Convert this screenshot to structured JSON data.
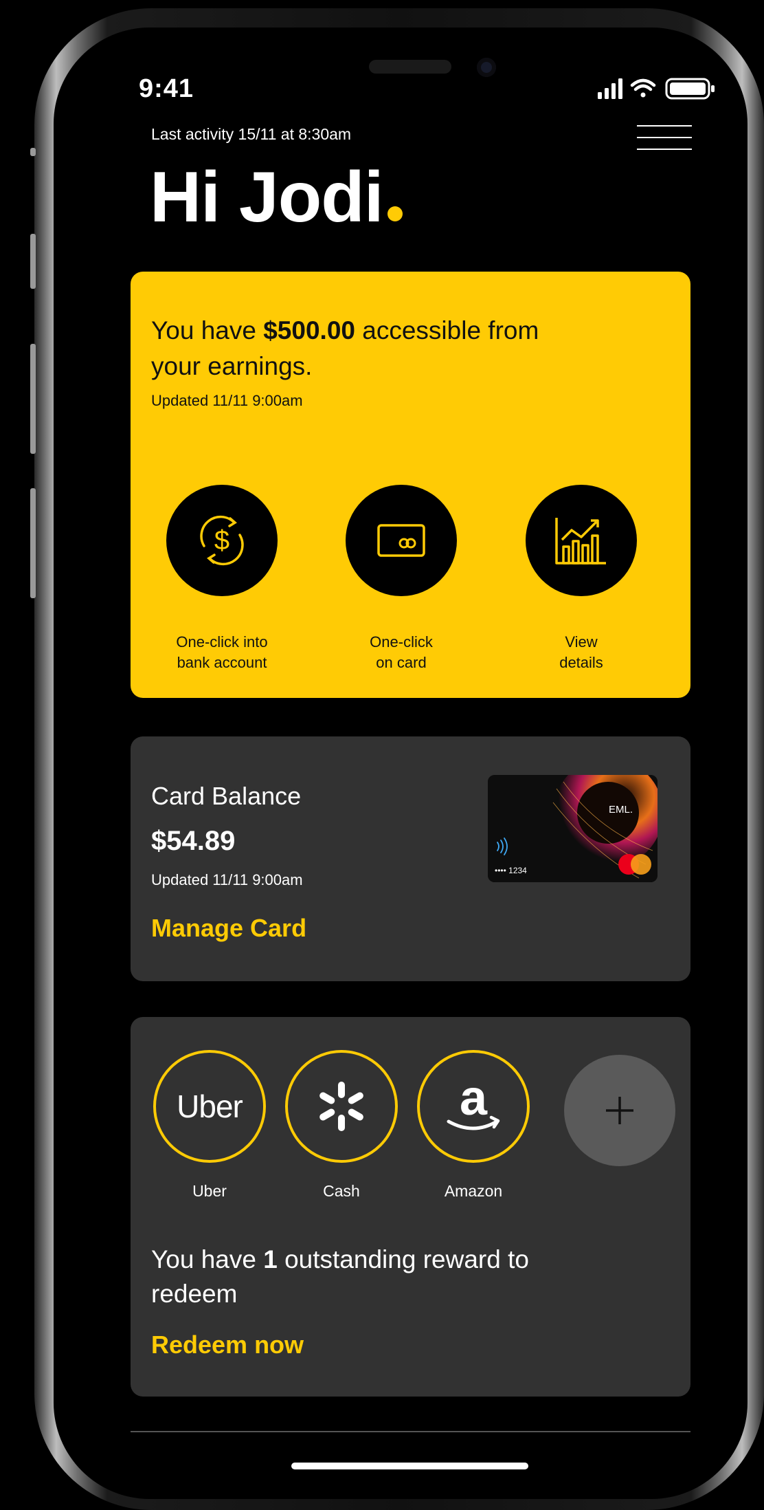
{
  "status_bar": {
    "time": "9:41"
  },
  "header": {
    "last_activity": "Last activity 15/11 at 8:30am",
    "greeting": "Hi Jodi"
  },
  "earnings": {
    "prefix": "You have ",
    "amount": "$500.00",
    "suffix": " accessible from your earnings.",
    "updated": "Updated 11/11 9:00am",
    "actions": [
      {
        "label": "One-click into\nbank account",
        "icon": "dollar-transfer-icon"
      },
      {
        "label": "One-click\non card",
        "icon": "card-icon"
      },
      {
        "label": "View\ndetails",
        "icon": "bar-chart-icon"
      }
    ]
  },
  "card_balance": {
    "title": "Card Balance",
    "amount": "$54.89",
    "updated": "Updated 11/11 9:00am",
    "link": "Manage Card",
    "card_brand": "EML.",
    "card_number": "•••• 1234"
  },
  "rewards": {
    "brands": [
      {
        "name": "Uber",
        "logo_text": "Uber"
      },
      {
        "name": "Cash",
        "logo_text": ""
      },
      {
        "name": "Amazon",
        "logo_text": "a"
      }
    ],
    "text_prefix": "You have ",
    "count": "1",
    "text_suffix": " outstanding reward to redeem",
    "link": "Redeem now"
  },
  "colors": {
    "accent": "#ffcb05",
    "card_bg": "#323232",
    "background": "#000000"
  }
}
